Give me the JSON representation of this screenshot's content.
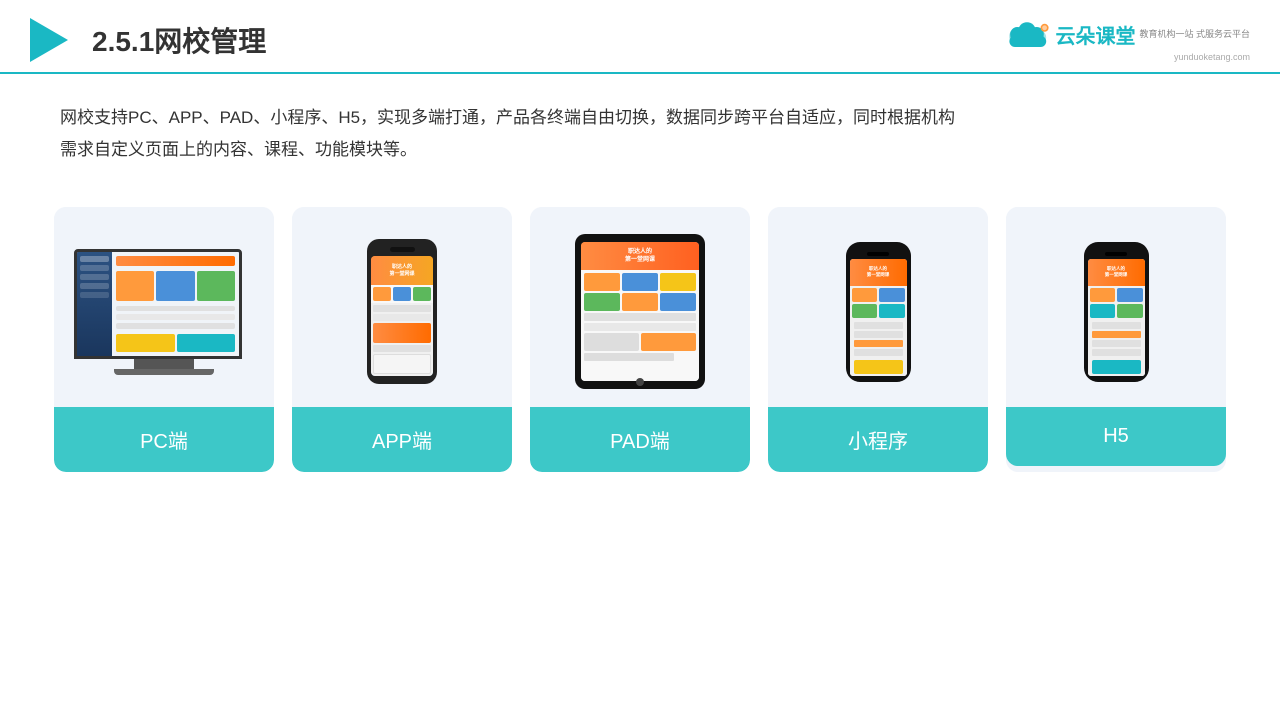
{
  "header": {
    "title": "2.5.1网校管理",
    "logo": {
      "brand": "云朵课堂",
      "tagline": "教育机构一站\n式服务云平台",
      "domain": "yunduoketang.com"
    }
  },
  "description": {
    "text1": "网校支持PC、APP、PAD、小程序、H5，实现多端打通，产品各终端自由切换，数据同步跨平台自适应，同时根据机构",
    "text2": "需求自定义页面上的内容、课程、功能模块等。"
  },
  "cards": [
    {
      "id": "pc",
      "label": "PC端"
    },
    {
      "id": "app",
      "label": "APP端"
    },
    {
      "id": "pad",
      "label": "PAD端"
    },
    {
      "id": "miniprogram",
      "label": "小程序"
    },
    {
      "id": "h5",
      "label": "H5"
    }
  ]
}
